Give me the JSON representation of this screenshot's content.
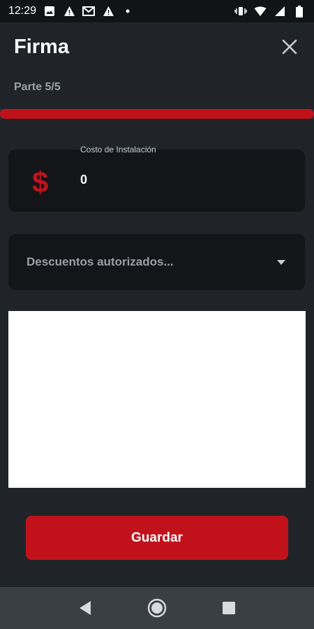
{
  "status_bar": {
    "time": "12:29",
    "left_icons": [
      "image-icon",
      "warning-icon",
      "gmail-icon",
      "warning-icon",
      "dot-icon"
    ],
    "right_icons": [
      "vibrate-icon",
      "wifi-icon",
      "signal-icon",
      "battery-icon"
    ]
  },
  "header": {
    "title": "Firma",
    "close_icon": "close-icon"
  },
  "step": {
    "label": "Parte 5/5",
    "progress": 1.0
  },
  "cost_field": {
    "label": "Costo de Instalación",
    "icon": "$",
    "value": "0"
  },
  "discount_select": {
    "placeholder": "Descuentos autorizados...",
    "icon": "dropdown-arrow-icon"
  },
  "signature_pad": {
    "content": ""
  },
  "actions": {
    "save_label": "Guardar"
  },
  "colors": {
    "background": "#202428",
    "accent": "#c1121c",
    "field_bg": "#131518",
    "muted_text": "#9aa0a6",
    "nav_bar": "#3a3f44"
  }
}
